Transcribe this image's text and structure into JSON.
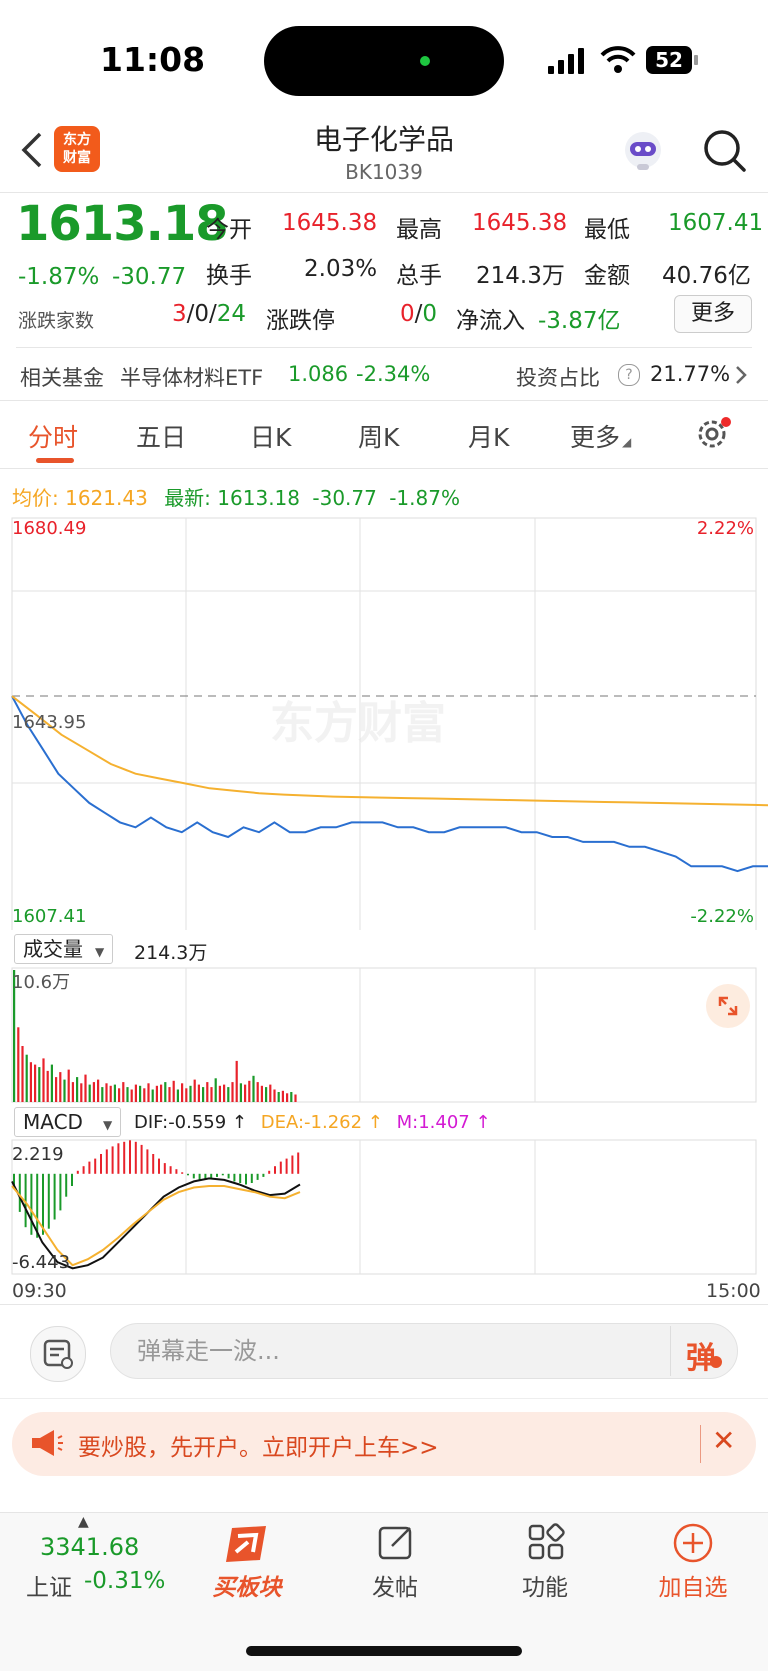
{
  "status": {
    "time": "11:08",
    "battery": "52"
  },
  "header": {
    "back_icon": "chevron-left-icon",
    "logo_text_line1": "东方",
    "logo_text_line2": "财富",
    "title": "电子化学品",
    "code": "BK1039"
  },
  "quote": {
    "price": "1613.18",
    "change_pct": "-1.87%",
    "change": "-30.77",
    "open_label": "今开",
    "open": "1645.38",
    "high_label": "最高",
    "high": "1645.38",
    "low_label": "最低",
    "low": "1607.41",
    "turnover_label": "换手",
    "turnover": "2.03%",
    "volume_label": "总手",
    "volume": "214.3万",
    "amount_label": "金额",
    "amount": "40.76亿",
    "updown_label": "涨跌家数",
    "up": "3",
    "flat": "0",
    "down": "24",
    "limit_label": "涨跌停",
    "limit_up": "0",
    "limit_down": "0",
    "netflow_label": "净流入",
    "netflow": "-3.87亿",
    "more_label": "更多"
  },
  "fund": {
    "label": "相关基金",
    "name": "半导体材料ETF",
    "price": "1.086",
    "change": "-2.34%",
    "ratio_label": "投资占比",
    "ratio": "21.77%"
  },
  "tabs": [
    "分时",
    "五日",
    "日K",
    "周K",
    "月K",
    "更多"
  ],
  "chart_info": {
    "avg_label": "均价:",
    "avg": "1621.43",
    "latest_label": "最新:",
    "latest": "1613.18",
    "latest_change": "-30.77",
    "latest_pct": "-1.87%"
  },
  "chart_data": [
    {
      "type": "line",
      "title": "",
      "y_top_label": "1680.49",
      "y_mid_label": "1643.95",
      "y_bottom_label": "1607.41",
      "pct_top_label": "2.22%",
      "pct_bottom_label": "-2.22%",
      "ylim": [
        1607.41,
        1680.49
      ],
      "prev_close": 1643.95,
      "x_start_label": "09:30",
      "x_end_label": "15:00",
      "series": [
        {
          "name": "price",
          "values": [
            1643.9,
            1638,
            1633,
            1628,
            1625,
            1622,
            1620,
            1618,
            1617,
            1619,
            1617,
            1616,
            1618,
            1616,
            1615,
            1617,
            1616,
            1618,
            1616,
            1616,
            1617,
            1617,
            1618,
            1618,
            1618,
            1617,
            1617,
            1616,
            1616,
            1617,
            1617,
            1617,
            1617,
            1616,
            1616,
            1615,
            1615,
            1614,
            1614,
            1614,
            1613,
            1613,
            1612,
            1611,
            1609,
            1609,
            1609,
            1608,
            1609,
            1609,
            1610,
            1610,
            1610,
            1611,
            1611,
            1612,
            1612,
            1613
          ]
        },
        {
          "name": "avg",
          "values": [
            1643.9,
            1640,
            1636,
            1633,
            1630,
            1628,
            1627,
            1626,
            1625,
            1624.5,
            1624,
            1623.7,
            1623.5,
            1623.3,
            1623.2,
            1623.1,
            1623,
            1622.9,
            1622.8,
            1622.7,
            1622.6,
            1622.5,
            1622.4,
            1622.3,
            1622.2,
            1622.1,
            1622,
            1621.9,
            1621.8,
            1621.7,
            1621.6,
            1621.5,
            1621.5,
            1621.4,
            1621.4,
            1621.4,
            1621.43
          ]
        }
      ]
    },
    {
      "type": "bar",
      "title": "成交量",
      "total_label": "214.3万",
      "max_label": "10.6万",
      "ylim": [
        0,
        10.6
      ],
      "values": [
        10.6,
        6,
        4.5,
        3.8,
        3.2,
        3,
        2.8,
        3.5,
        2.5,
        3,
        2,
        2.4,
        1.8,
        2.6,
        1.6,
        2,
        1.5,
        2.2,
        1.4,
        1.6,
        1.8,
        1.2,
        1.5,
        1.3,
        1.4,
        1.1,
        1.6,
        1.2,
        1,
        1.4,
        1.3,
        1.1,
        1.5,
        1,
        1.3,
        1.4,
        1.6,
        1.2,
        1.7,
        1,
        1.5,
        1.1,
        1.3,
        1.8,
        1.4,
        1.2,
        1.6,
        1.2,
        1.9,
        1.3,
        1.4,
        1.2,
        1.6,
        3.3,
        1.5,
        1.4,
        1.7,
        2.1,
        1.6,
        1.3,
        1.2,
        1.4,
        1,
        0.8,
        0.9,
        0.7,
        0.8,
        0.6
      ]
    },
    {
      "type": "bar",
      "title": "MACD",
      "dif_label": "DIF:-0.559 ↑",
      "dea_label": "DEA:-1.262 ↑",
      "m_label": "M:1.407 ↑",
      "y_top_label": "2.219",
      "y_bottom_label": "-6.443",
      "ylim": [
        -6.443,
        2.219
      ],
      "values": [
        -1,
        -2.5,
        -3.5,
        -4,
        -4.2,
        -4,
        -3.6,
        -3,
        -2.4,
        -1.5,
        -0.8,
        0.2,
        0.5,
        0.8,
        1,
        1.3,
        1.6,
        1.8,
        2,
        2.1,
        2.2,
        2.1,
        1.9,
        1.6,
        1.3,
        1,
        0.7,
        0.5,
        0.3,
        0.1,
        -0.1,
        -0.3,
        -0.4,
        -0.4,
        -0.3,
        -0.2,
        -0.1,
        -0.3,
        -0.5,
        -0.6,
        -0.7,
        -0.6,
        -0.4,
        -0.2,
        0.2,
        0.5,
        0.8,
        1.0,
        1.2,
        1.4
      ]
    }
  ],
  "chart_labels": {
    "volume_select": "成交量",
    "macd_select": "MACD"
  },
  "input": {
    "placeholder": "弹幕走一波...",
    "danmu_button": "弹"
  },
  "banner": {
    "text": "要炒股，先开户。立即开户上车>>"
  },
  "bottom_nav": {
    "index_value": "3341.68",
    "index_name": "上证",
    "index_change": "-0.31%",
    "buy_label": "买板块",
    "post_label": "发帖",
    "func_label": "功能",
    "add_label": "加自选"
  }
}
